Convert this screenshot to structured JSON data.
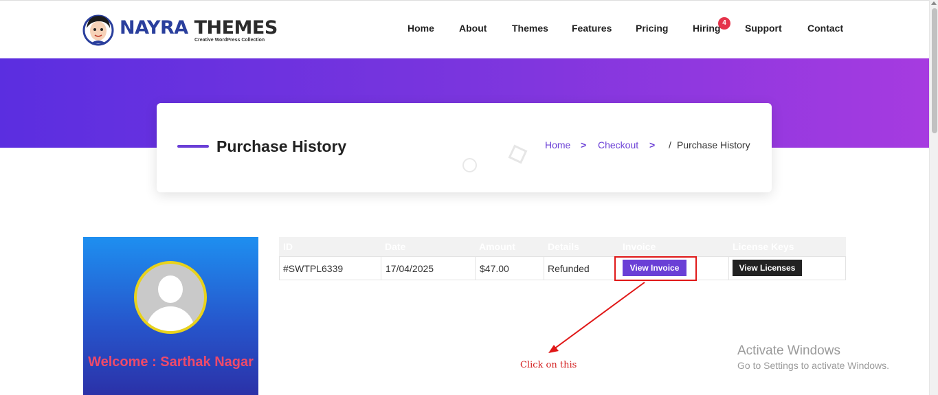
{
  "logo": {
    "word1": "NAYRA",
    "word2": "THEMES",
    "tagline": "Creative WordPress Collection"
  },
  "nav": {
    "items": [
      "Home",
      "About",
      "Themes",
      "Features",
      "Pricing",
      "Hiring",
      "Support",
      "Contact"
    ],
    "hiring_badge": "4"
  },
  "title_card": {
    "title": "Purchase History",
    "breadcrumb": {
      "home": "Home",
      "checkout": "Checkout",
      "separator": ">",
      "current_prefix": "/",
      "current": "Purchase History"
    }
  },
  "profile": {
    "welcome": "Welcome : Sarthak Nagar"
  },
  "table": {
    "headers": [
      "ID",
      "Date",
      "Amount",
      "Details",
      "Invoice",
      "License Keys"
    ],
    "rows": [
      {
        "id": "#SWTPL6339",
        "date": "17/04/2025",
        "amount": "$47.00",
        "details": "Refunded",
        "invoice_button": "View Invoice",
        "license_button": "View Licenses"
      }
    ]
  },
  "annotation": {
    "text": "Click on this",
    "color": "#d31c1c"
  },
  "watermark": {
    "title": "Activate Windows",
    "subtitle": "Go to Settings to activate Windows."
  },
  "colors": {
    "accent": "#6a3fd6",
    "hero_start": "#5b2ee0",
    "hero_end": "#a63be0",
    "welcome": "#ee4a6a",
    "badge": "#e5334b"
  },
  "icons": {
    "avatar": "user-placeholder-icon",
    "breadcrumb_separator": "chevron-right-icon"
  }
}
